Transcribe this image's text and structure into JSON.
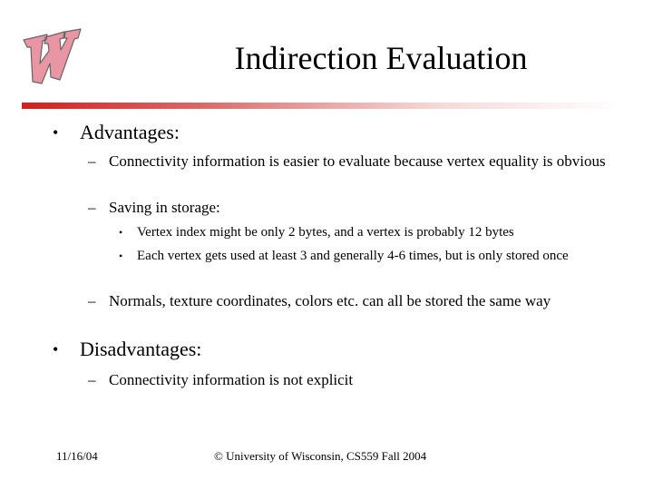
{
  "slide": {
    "title": "Indirection Evaluation",
    "logo": "wisconsin-w-logo",
    "accent_color": "#d41e1e"
  },
  "body": {
    "advantages": {
      "bullet": "•",
      "label": "Advantages:",
      "items": [
        {
          "dash": "–",
          "text": "Connectivity information is easier to evaluate because vertex equality is obvious"
        },
        {
          "dash": "–",
          "text": "Saving in storage:",
          "subitems": [
            {
              "dot": "•",
              "text": "Vertex index might be only 2 bytes, and a vertex is probably 12 bytes"
            },
            {
              "dot": "•",
              "text": "Each vertex gets used at least 3 and generally 4-6 times, but is only stored once"
            }
          ]
        },
        {
          "dash": "–",
          "text": "Normals, texture coordinates, colors etc. can all be stored the same way"
        }
      ]
    },
    "disadvantages": {
      "bullet": "•",
      "label": "Disadvantages:",
      "items": [
        {
          "dash": "–",
          "text": "Connectivity information is not explicit"
        }
      ]
    }
  },
  "footer": {
    "date": "11/16/04",
    "copyright": "© University of Wisconsin, CS559 Fall 2004"
  }
}
